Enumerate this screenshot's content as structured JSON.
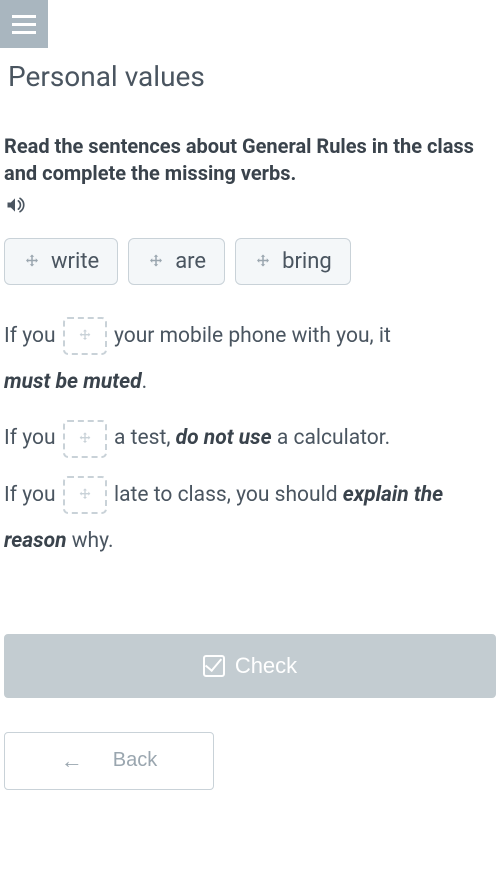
{
  "header": {
    "title": "Personal values"
  },
  "exercise": {
    "instructions": "Read the sentences about General Rules in the class and complete the missing verbs.",
    "chips": [
      "write",
      "are",
      "bring"
    ],
    "sentences": [
      {
        "before": "If you ",
        "after1": " your mobile phone with you, it ",
        "emph1": "must be muted",
        "after2": "."
      },
      {
        "before": "If you ",
        "after1": " a test, ",
        "emph1": "do not use",
        "after2": " a calculator."
      },
      {
        "before": "If you ",
        "after1": " late to class, you should ",
        "emph1": "explain the reason",
        "after2": " why."
      }
    ]
  },
  "buttons": {
    "check": "Check",
    "back": "Back"
  }
}
